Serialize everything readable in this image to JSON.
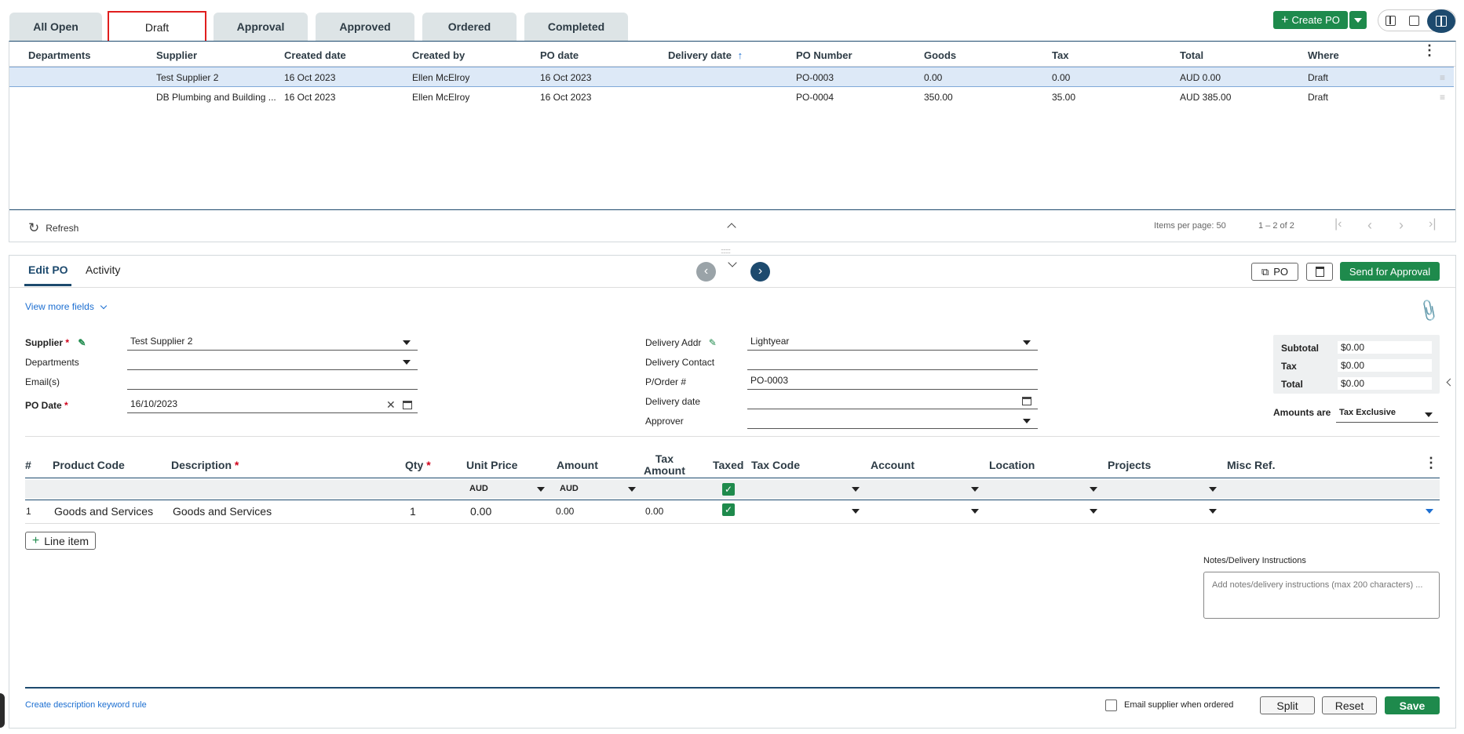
{
  "tabs": [
    "All Open",
    "Draft",
    "Approval",
    "Approved",
    "Ordered",
    "Completed"
  ],
  "create_po_label": "Create PO",
  "grid": {
    "headers": [
      "Departments",
      "Supplier",
      "Created date",
      "Created by",
      "PO date",
      "Delivery date",
      "PO Number",
      "Goods",
      "Tax",
      "Total",
      "Where"
    ],
    "rows": [
      {
        "supplier": "Test Supplier 2",
        "created": "16 Oct 2023",
        "by": "Ellen McElroy",
        "po_date": "16 Oct 2023",
        "po_number": "PO-0003",
        "goods": "0.00",
        "tax": "0.00",
        "total": "AUD 0.00",
        "where": "Draft"
      },
      {
        "supplier": "DB Plumbing and Building ...",
        "created": "16 Oct 2023",
        "by": "Ellen McElroy",
        "po_date": "16 Oct 2023",
        "po_number": "PO-0004",
        "goods": "350.00",
        "tax": "35.00",
        "total": "AUD 385.00",
        "where": "Draft"
      }
    ],
    "refresh": "Refresh",
    "items_per_page_label": "Items per page:",
    "items_per_page": "50",
    "range": "1 – 2 of 2"
  },
  "edit": {
    "tabs": [
      "Edit PO",
      "Activity"
    ],
    "po_button": "PO",
    "send_button": "Send for Approval",
    "view_more": "View more fields",
    "supplier_label": "Supplier",
    "supplier_value": "Test Supplier 2",
    "departments_label": "Departments",
    "emails_label": "Email(s)",
    "po_date_label": "PO Date",
    "po_date_value": "16/10/2023",
    "delivery_addr_label": "Delivery Addr",
    "delivery_addr_value": "Lightyear",
    "delivery_contact_label": "Delivery Contact",
    "porder_label": "P/Order #",
    "porder_value": "PO-0003",
    "delivery_date_label": "Delivery date",
    "approver_label": "Approver",
    "subtotal_label": "Subtotal",
    "subtotal_value": "$0.00",
    "tax_label": "Tax",
    "tax_value": "$0.00",
    "total_label": "Total",
    "total_value": "$0.00",
    "amounts_are_label": "Amounts are",
    "amounts_are_value": "Tax Exclusive"
  },
  "lines": {
    "headers": {
      "num": "#",
      "product": "Product Code",
      "description": "Description",
      "qty": "Qty",
      "unit_price": "Unit Price",
      "amount": "Amount",
      "tax_amount_1": "Tax",
      "tax_amount_2": "Amount",
      "taxed": "Taxed",
      "tax_code": "Tax Code",
      "account": "Account",
      "location": "Location",
      "projects": "Projects",
      "misc": "Misc Ref."
    },
    "currency_unit": "AUD",
    "currency_amount": "AUD",
    "row": {
      "num": "1",
      "product": "Goods and Services",
      "description": "Goods and Services",
      "qty": "1",
      "unit_price": "0.00",
      "amount": "0.00",
      "tax_amount": "0.00"
    },
    "add_line": "Line item"
  },
  "notes_label": "Notes/Delivery Instructions",
  "notes_placeholder": "Add notes/delivery instructions (max 200 characters) ...",
  "footer": {
    "keyword_rule": "Create description keyword rule",
    "email_supplier": "Email supplier when ordered",
    "split": "Split",
    "reset": "Reset",
    "save": "Save"
  },
  "colors": {
    "accent": "#1e8a4c",
    "navy": "#1d4a6e",
    "selected_row": "#dde9f7",
    "active_tab_border": "#e01e1e"
  }
}
